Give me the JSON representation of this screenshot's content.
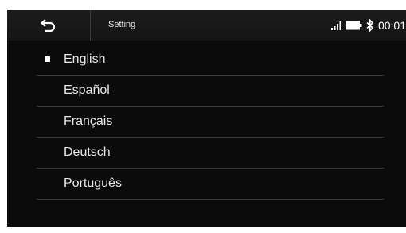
{
  "header": {
    "title": "Setting",
    "back_icon": "back-arrow-icon"
  },
  "status": {
    "clock": "00:01",
    "icons": [
      "signal-icon",
      "battery-icon",
      "bluetooth-icon"
    ]
  },
  "languages": {
    "selected": "English",
    "items": [
      {
        "label": "English",
        "selected": true
      },
      {
        "label": "Español",
        "selected": false
      },
      {
        "label": "Français",
        "selected": false
      },
      {
        "label": "Deutsch",
        "selected": false
      },
      {
        "label": "Português",
        "selected": false
      }
    ]
  },
  "colors": {
    "background": "#0b0b0b",
    "text": "#e9e9e9",
    "divider": "#3b3b3b"
  }
}
